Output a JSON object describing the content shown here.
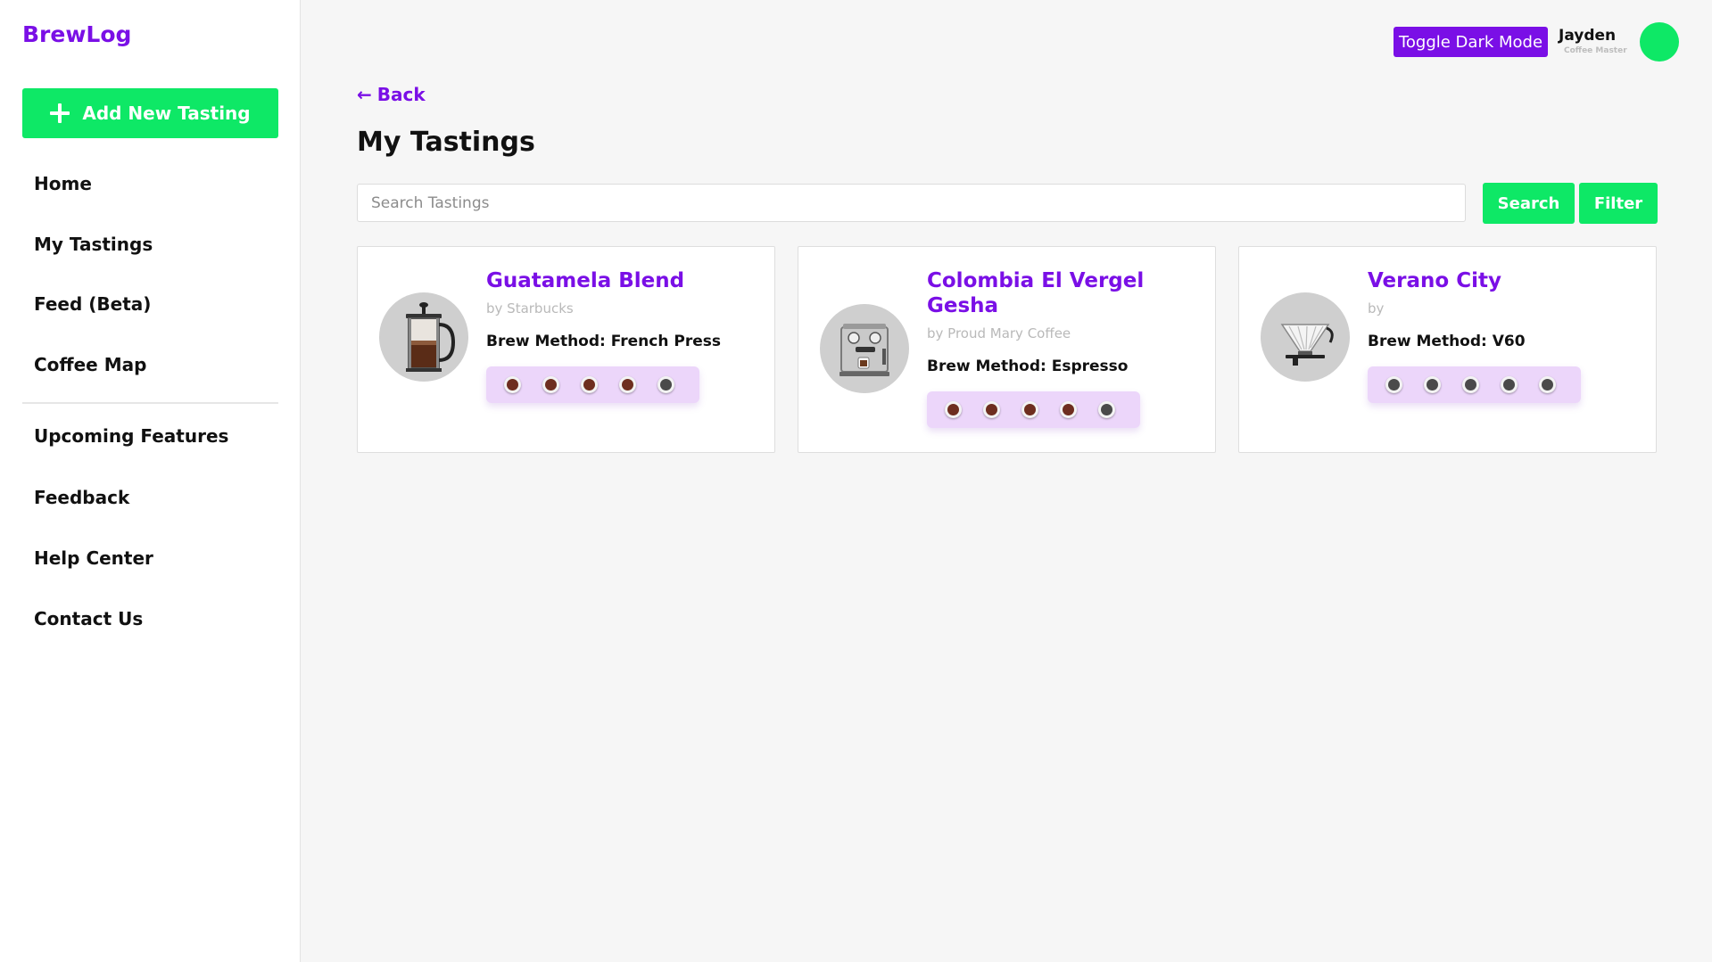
{
  "app": {
    "logo": "BrewLog"
  },
  "sidebar": {
    "add_button_label": "Add New Tasting",
    "nav_primary": [
      {
        "label": "Home"
      },
      {
        "label": "My Tastings"
      },
      {
        "label": "Feed (Beta)"
      },
      {
        "label": "Coffee Map"
      }
    ],
    "nav_secondary": [
      {
        "label": "Upcoming Features"
      },
      {
        "label": "Feedback"
      },
      {
        "label": "Help Center"
      },
      {
        "label": "Contact Us"
      }
    ]
  },
  "header": {
    "dark_mode_label": "Toggle Dark Mode",
    "user_name": "Jayden",
    "user_role": "Coffee Master"
  },
  "main": {
    "back_label": "Back",
    "back_arrow": "←",
    "title": "My Tastings",
    "search_placeholder": "Search Tastings",
    "search_button": "Search",
    "filter_button": "Filter"
  },
  "tastings": [
    {
      "title": "Guatamela Blend",
      "roaster": "by Starbucks",
      "brew_method": "Brew Method: French Press",
      "image_icon": "french-press-icon",
      "rating": 4,
      "rating_max": 5
    },
    {
      "title": "Colombia El Vergel Gesha",
      "roaster": "by Proud Mary Coffee",
      "brew_method": "Brew Method: Espresso",
      "image_icon": "espresso-machine-icon",
      "rating": 4,
      "rating_max": 5
    },
    {
      "title": "Verano City",
      "roaster": "by",
      "brew_method": "Brew Method: V60",
      "image_icon": "v60-dripper-icon",
      "rating": 0,
      "rating_max": 5
    }
  ],
  "colors": {
    "brand_purple": "#7a0fe6",
    "brand_green": "#0ee866",
    "rating_bg": "#ecd6fa",
    "cup_filled": "#6e2e1f",
    "cup_empty": "#4a4a4a"
  }
}
